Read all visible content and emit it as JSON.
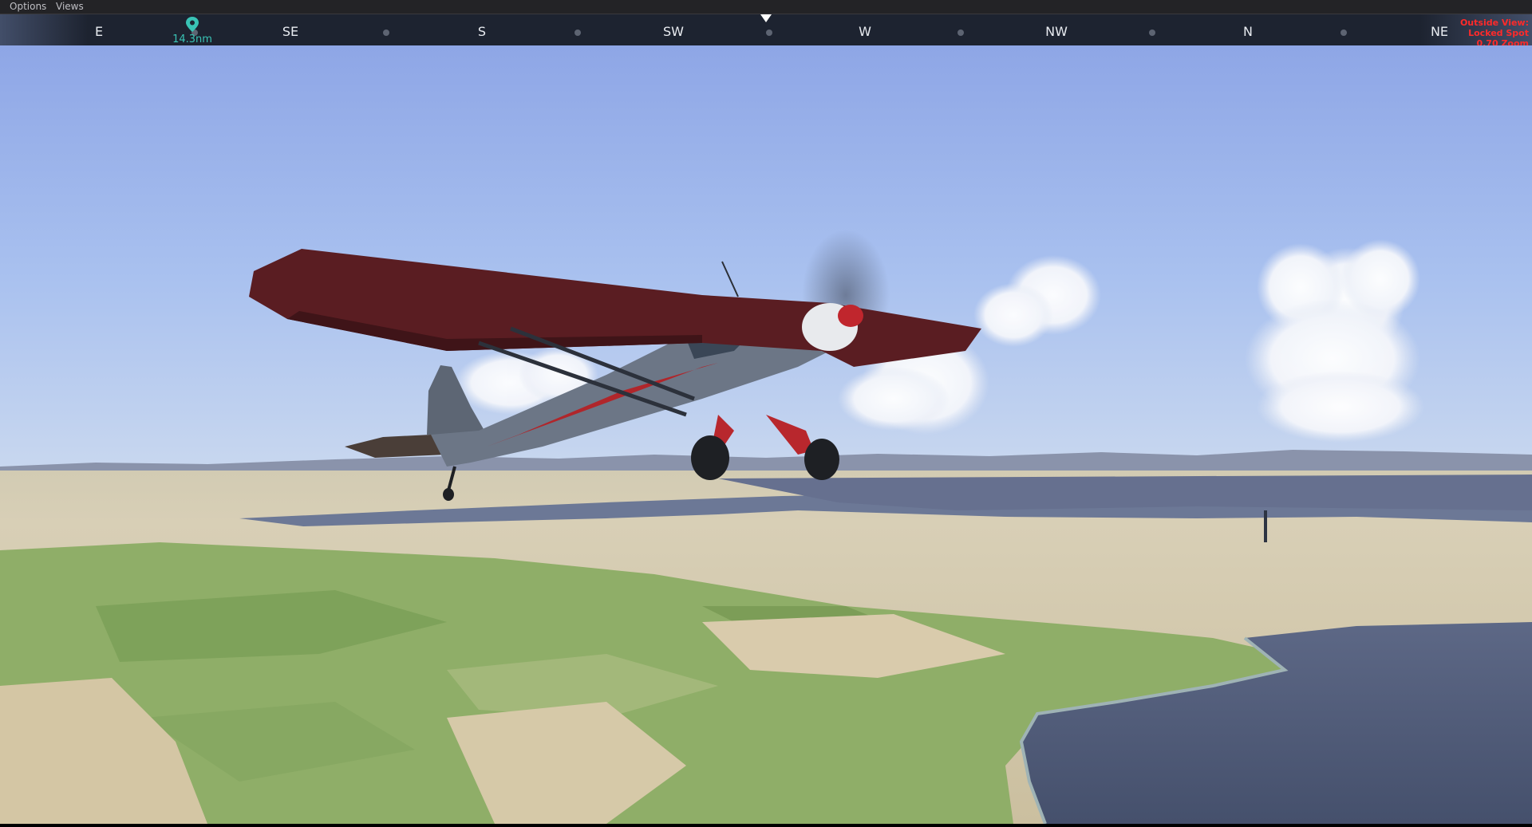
{
  "menu": {
    "options": "Options",
    "views": "Views"
  },
  "compass": {
    "directions": [
      "E",
      "SE",
      "S",
      "SW",
      "W",
      "NW",
      "N",
      "NE"
    ]
  },
  "waypoint": {
    "distance": "14.3nm",
    "icon": "map-pin-icon",
    "color": "#39c3b5"
  },
  "view_info": {
    "line1": "Outside View:",
    "line2": "Locked Spot",
    "line3": "0.70 Zoom",
    "color": "#ff2a2a"
  },
  "scene": {
    "description_icons": [
      "aircraft",
      "clouds",
      "terrain",
      "water"
    ],
    "aircraft_colors": {
      "fuselage": "#6b7584",
      "wing": "#5a1a1f",
      "accent": "#c3272c"
    }
  }
}
